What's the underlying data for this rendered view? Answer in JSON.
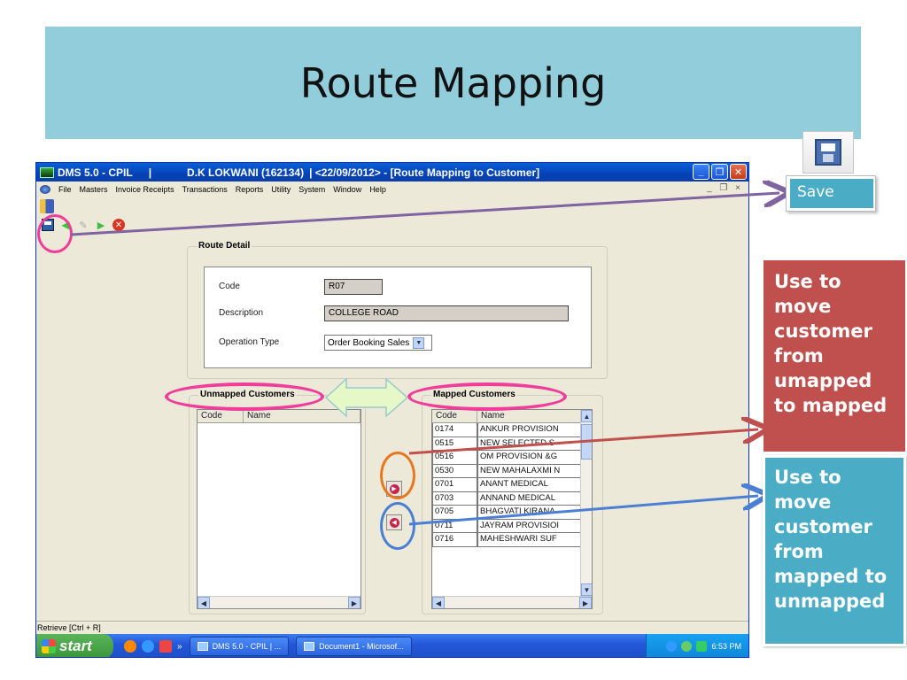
{
  "slide": {
    "title": "Route Mapping"
  },
  "window": {
    "title_app": "DMS 5.0 - CPIL",
    "title_sep": "|",
    "title_user": "D.K LOKWANI (162134)",
    "title_rest": "|  <22/09/2012>  - [Route Mapping to Customer]",
    "btn_min": "_",
    "btn_max": "❐",
    "btn_close": "✕"
  },
  "menu": [
    "File",
    "Masters",
    "Invoice Receipts",
    "Transactions",
    "Reports",
    "Utility",
    "System",
    "Window",
    "Help"
  ],
  "menu_mdi": "_ ❐ ×",
  "route_detail": {
    "legend": "Route Detail",
    "code_label": "Code",
    "code_value": "R07",
    "desc_label": "Description",
    "desc_value": "COLLEGE ROAD",
    "op_label": "Operation Type",
    "op_value": "Order Booking Sales"
  },
  "unmapped": {
    "legend": "Unmapped Customers",
    "col_code": "Code",
    "col_name": "Name"
  },
  "mapped": {
    "legend": "Mapped Customers",
    "col_code": "Code",
    "col_name": "Name",
    "rows": [
      [
        "0174",
        "ANKUR PROVISION"
      ],
      [
        "0515",
        "NEW SELECTED  S"
      ],
      [
        "0516",
        "OM PROVISION &G"
      ],
      [
        "0530",
        "NEW MAHALAXMI N"
      ],
      [
        "0701",
        "ANANT MEDICAL"
      ],
      [
        "0703",
        "ANNAND MEDICAL"
      ],
      [
        "0705",
        "BHAGVATI KIRANA"
      ],
      [
        "0711",
        "JAYRAM PROVISIOI"
      ],
      [
        "0716",
        "MAHESHWARI SUF"
      ]
    ]
  },
  "status": "Retrieve [Ctrl + R]",
  "taskbar": {
    "start": "start",
    "chevron": "»",
    "task1": "DMS 5.0 - CPIL   |   ...",
    "task2": "Document1 - Microsof...",
    "clock": "6:53 PM"
  },
  "annotations": {
    "save": "Save",
    "to_mapped": "Use to move customer from umapped to mapped",
    "to_unmapped": "Use to move customer from mapped to unmapped"
  },
  "colors": {
    "banner": "#92cddc",
    "callout_red": "#c0504d",
    "callout_blue": "#4bacc6",
    "ellipse_pink": "#f03c9a",
    "ellipse_orange": "#e87722",
    "ellipse_blue": "#4a7fd4",
    "arrow_purple": "#8064a2"
  }
}
